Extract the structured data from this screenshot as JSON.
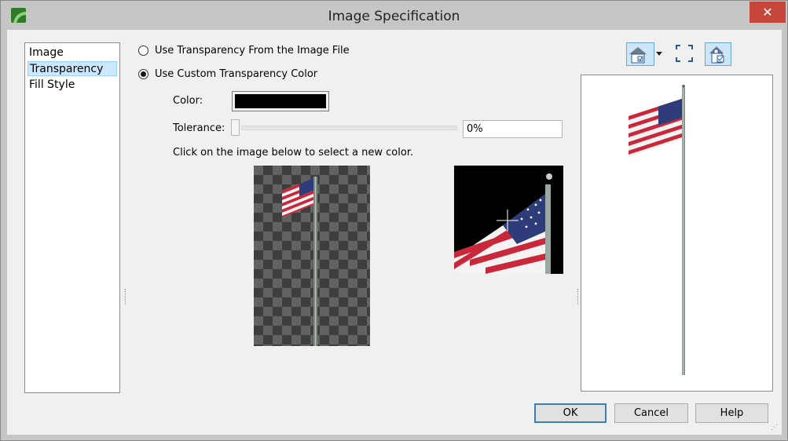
{
  "window": {
    "title": "Image Specification",
    "close_label": "✕"
  },
  "nav": {
    "items": [
      {
        "label": "Image"
      },
      {
        "label": "Transparency"
      },
      {
        "label": "Fill Style"
      }
    ],
    "selected": "Transparency"
  },
  "transparency": {
    "option_file": "Use Transparency From the Image File",
    "option_custom": "Use Custom Transparency Color",
    "selected_option": "Use Custom Transparency Color",
    "color_label": "Color:",
    "color_value": "#000000",
    "tolerance_label": "Tolerance:",
    "tolerance_value": "0%",
    "tolerance_fraction": 0,
    "instruction": "Click on the image below to select a new color."
  },
  "toolbar": {
    "icons": [
      "house-view-icon",
      "dropdown-arrow-icon",
      "fill-window-icon",
      "preview-icon"
    ]
  },
  "buttons": {
    "ok": "OK",
    "cancel": "Cancel",
    "help": "Help"
  },
  "colors": {
    "accent": "#3c7fb1",
    "selection": "#cce8ff",
    "close": "#c7463c"
  }
}
